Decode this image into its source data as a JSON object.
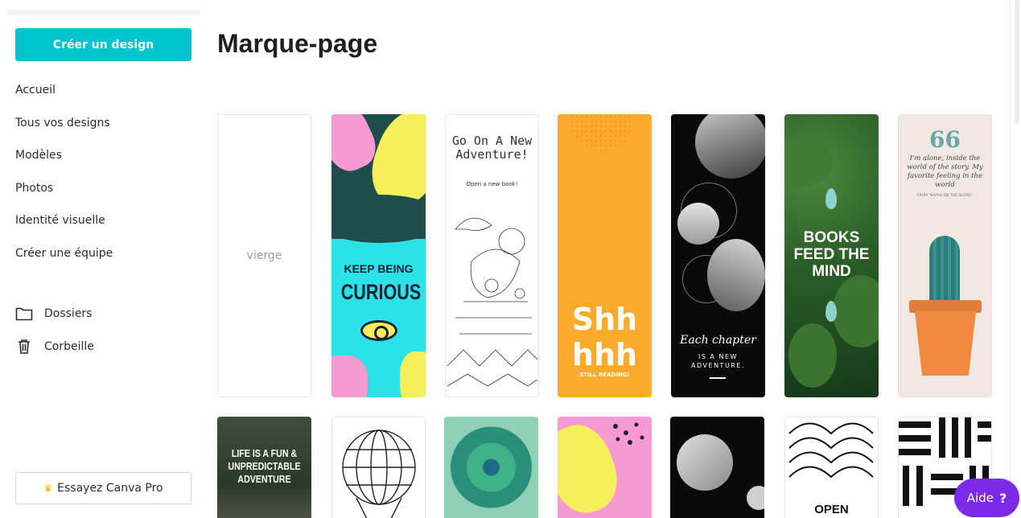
{
  "sidebar": {
    "create_button": "Créer un design",
    "nav_items": [
      "Accueil",
      "Tous vos designs",
      "Modèles",
      "Photos",
      "Identité visuelle",
      "Créer une équipe"
    ],
    "folders_label": "Dossiers",
    "trash_label": "Corbeille",
    "pro_button": "Essayez Canva Pro"
  },
  "main": {
    "title": "Marque-page",
    "blank_label": "vierge",
    "templates": {
      "curious": {
        "line1": "KEEP BEING",
        "line2": "CURIOUS"
      },
      "adventure": {
        "title": "Go On A New Adventure!",
        "subtitle": "Open a new book!"
      },
      "shh": {
        "title": "Shh hhh",
        "subtitle": "STILL READING!"
      },
      "chapter": {
        "title": "Each chapter",
        "subtitle": "IS A NEW ADVENTURE."
      },
      "books": {
        "title": "BOOKS FEED THE MIND"
      },
      "quote": {
        "mark": "66",
        "text": "I'm alone, inside the world of the story. My favorite feeling in the world",
        "source": "FROM \"KAFKA ON THE SHORE\""
      },
      "life": {
        "title": "LIFE IS A FUN & UNPREDICTABLE ADVENTURE"
      },
      "open": {
        "title": "OPEN"
      }
    }
  },
  "help_button": {
    "label": "Aide",
    "icon": "?"
  },
  "colors": {
    "accent": "#00c4cc",
    "help": "#7d2ae8"
  }
}
